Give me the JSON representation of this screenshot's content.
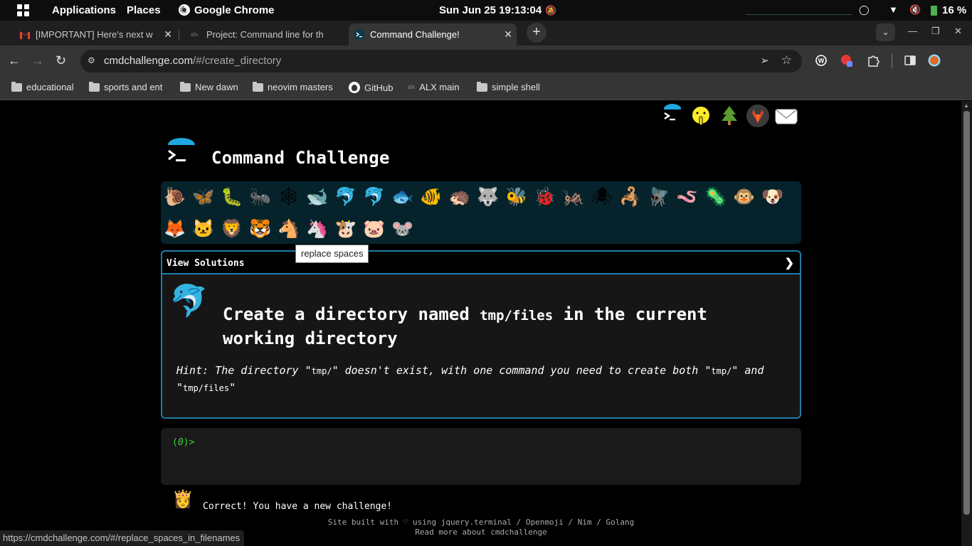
{
  "panel": {
    "applications": "Applications",
    "places": "Places",
    "active_app": "Google Chrome",
    "clock": "Sun Jun 25  19:13:04",
    "battery": "16 %"
  },
  "tabs": [
    {
      "title": "[IMPORTANT] Here's next w",
      "favicon": "gmail-icon",
      "active": false
    },
    {
      "title": "Project: Command line for th",
      "favicon": "alx-icon",
      "active": false
    },
    {
      "title": "Command Challenge!",
      "favicon": "terminal-icon",
      "active": true
    }
  ],
  "toolbar": {
    "url_host": "cmdchallenge.com",
    "url_path": "/#/create_directory"
  },
  "bookmarks": [
    {
      "label": "educational",
      "icon": "folder-icon"
    },
    {
      "label": "sports and ent",
      "icon": "folder-icon"
    },
    {
      "label": "New dawn",
      "icon": "folder-icon"
    },
    {
      "label": "neovim masters",
      "icon": "folder-icon"
    },
    {
      "label": "GitHub",
      "icon": "github-icon"
    },
    {
      "label": "ALX main",
      "icon": "alx-icon"
    },
    {
      "label": "simple shell",
      "icon": "folder-icon"
    }
  ],
  "site": {
    "title": "Command Challenge",
    "top_icons": [
      "terminal-logo-icon",
      "shushing-face-icon",
      "tree-icon",
      "gitlab-icon",
      "mail-icon"
    ]
  },
  "challenge_icons": [
    {
      "emoji": "🐌",
      "name": "snail-icon"
    },
    {
      "emoji": "🦋",
      "name": "butterfly-icon"
    },
    {
      "emoji": "🐛",
      "name": "caterpillar-icon"
    },
    {
      "emoji": "🐜",
      "name": "ant-icon"
    },
    {
      "emoji": "🕸",
      "name": "spider-web-icon"
    },
    {
      "emoji": "🐋",
      "name": "whale-icon"
    },
    {
      "emoji": "🐬",
      "name": "dolphin-icon"
    },
    {
      "emoji": "🐬",
      "name": "dolphin-icon"
    },
    {
      "emoji": "🐟",
      "name": "fish-icon"
    },
    {
      "emoji": "🐠",
      "name": "tropical-fish-icon"
    },
    {
      "emoji": "🦔",
      "name": "hedgehog-icon"
    },
    {
      "emoji": "🐺",
      "name": "wolf-icon"
    },
    {
      "emoji": "🐝",
      "name": "bee-icon"
    },
    {
      "emoji": "🐞",
      "name": "ladybug-icon"
    },
    {
      "emoji": "🦗",
      "name": "cricket-icon"
    },
    {
      "emoji": "🕷",
      "name": "spider-icon"
    },
    {
      "emoji": "🦂",
      "name": "scorpion-icon"
    },
    {
      "emoji": "🪰",
      "name": "fly-icon"
    },
    {
      "emoji": "🪱",
      "name": "worm-icon"
    },
    {
      "emoji": "🦠",
      "name": "microbe-icon"
    },
    {
      "emoji": "🐵",
      "name": "monkey-icon"
    },
    {
      "emoji": "🐶",
      "name": "dog-icon"
    },
    {
      "emoji": "🦊",
      "name": "fox-icon"
    },
    {
      "emoji": "🐱",
      "name": "cat-icon"
    },
    {
      "emoji": "🦁",
      "name": "lion-icon"
    },
    {
      "emoji": "🐯",
      "name": "tiger-icon"
    },
    {
      "emoji": "🐴",
      "name": "horse-icon"
    },
    {
      "emoji": "🦄",
      "name": "unicorn-icon"
    },
    {
      "emoji": "🐮",
      "name": "cow-icon"
    },
    {
      "emoji": "🐷",
      "name": "pig-icon"
    },
    {
      "emoji": "🐭",
      "name": "mouse-icon"
    }
  ],
  "tooltip": "replace spaces",
  "challenge": {
    "view_solutions": "View Solutions",
    "chevron": "❯",
    "icon": "🐬",
    "title_pre": "Create a directory named ",
    "title_code": "tmp/files",
    "title_post": " in the current working directory",
    "hint_1": "Hint: The directory \"",
    "hint_code_1": "tmp/",
    "hint_2": "\" doesn't exist, with one command you need to create both \"",
    "hint_code_2": "tmp/",
    "hint_3": "\" and \"",
    "hint_code_3": "tmp/files",
    "hint_4": "\""
  },
  "terminal": {
    "prompt_open": "(",
    "prompt_count": "0",
    "prompt_close": ")>"
  },
  "result": {
    "icon": "👸",
    "text": "Correct! You have a new challenge!"
  },
  "footer": {
    "line1": "Site built with ♡ using jquery.terminal / Openmoji / Nim / Golang",
    "line2": "Read more about cmdchallenge"
  },
  "status_url": "https://cmdchallenge.com/#/replace_spaces_in_filenames"
}
